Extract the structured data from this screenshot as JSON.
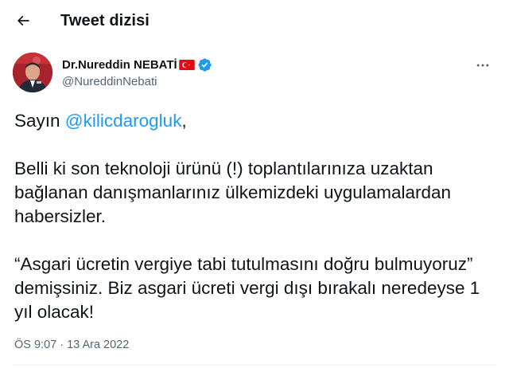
{
  "header": {
    "back_icon": "arrow-left-icon",
    "title": "Tweet dizisi"
  },
  "author": {
    "display_name": "Dr.Nureddin NEBATİ",
    "handle": "@NureddinNebati",
    "flag_icon": "turkish-flag-icon",
    "verified_icon": "verified-badge-icon",
    "verified_color": "#1d9bf0"
  },
  "more_icon": "more-horizontal-icon",
  "tweet": {
    "greeting": "Sayın ",
    "mention": "@kilicdarogluk",
    "greeting_end": ",",
    "paragraph_2": "Belli ki son teknoloji ürünü (!) toplantılarınıza uzaktan bağlanan danışmanlarınız ülkemizdeki uygulamalardan habersizler.",
    "paragraph_3": "“Asgari ücretin vergiye tabi tutulmasını doğru bulmuyoruz” demişsiniz. Biz asgari ücreti vergi dışı bırakalı neredeyse 1 yıl olacak!"
  },
  "timestamp": "ÖS 9:07 · 13 Ara 2022",
  "colors": {
    "text": "#0f1419",
    "secondary": "#536471",
    "accent": "#1d9bf0",
    "flag_red": "#e30a17"
  }
}
